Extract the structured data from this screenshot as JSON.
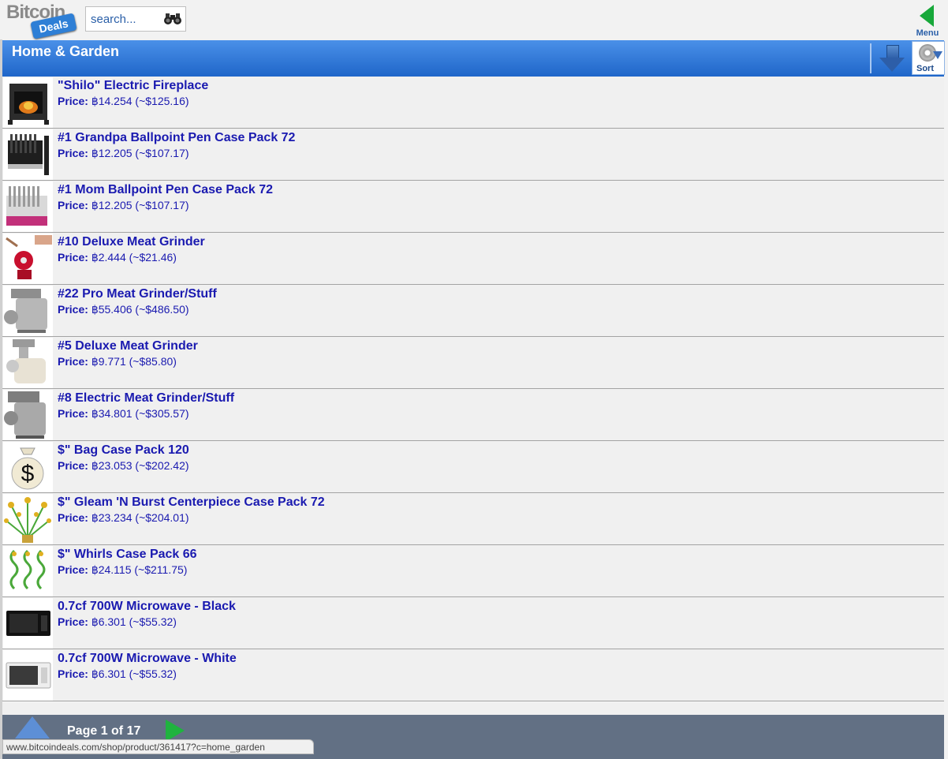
{
  "header": {
    "logo_text_top": "Bitcoin",
    "logo_text_tag": "Deals",
    "search_placeholder": "search...",
    "menu_label": "Menu"
  },
  "category": {
    "title": "Home & Garden",
    "sort_label": "Sort"
  },
  "price_label": "Price:",
  "products": [
    {
      "name": "\"Shilo\" Electric Fireplace",
      "price": "฿14.254 (~$125.16)",
      "icon": "fireplace"
    },
    {
      "name": "#1 Grandpa Ballpoint Pen Case Pack 72",
      "price": "฿12.205 (~$107.17)",
      "icon": "pens"
    },
    {
      "name": "#1 Mom Ballpoint Pen Case Pack 72",
      "price": "฿12.205 (~$107.17)",
      "icon": "pens"
    },
    {
      "name": "#10 Deluxe Meat Grinder",
      "price": "฿2.444 (~$21.46)",
      "icon": "grinder"
    },
    {
      "name": "#22 Pro Meat Grinder/Stuff",
      "price": "฿55.406 (~$486.50)",
      "icon": "grinder"
    },
    {
      "name": "#5 Deluxe Meat Grinder",
      "price": "฿9.771 (~$85.80)",
      "icon": "grinder"
    },
    {
      "name": "#8 Electric Meat Grinder/Stuff",
      "price": "฿34.801 (~$305.57)",
      "icon": "grinder"
    },
    {
      "name": "$\" Bag Case Pack 120",
      "price": "฿23.053 (~$202.42)",
      "icon": "money-bag"
    },
    {
      "name": "$\" Gleam 'N Burst Centerpiece Case Pack 72",
      "price": "฿23.234 (~$204.01)",
      "icon": "centerpiece"
    },
    {
      "name": "$\" Whirls Case Pack 66",
      "price": "฿24.115 (~$211.75)",
      "icon": "whirls"
    },
    {
      "name": "0.7cf 700W Microwave - Black",
      "price": "฿6.301 (~$55.32)",
      "icon": "microwave-black"
    },
    {
      "name": "0.7cf 700W Microwave - White",
      "price": "฿6.301 (~$55.32)",
      "icon": "microwave-white"
    }
  ],
  "pager": {
    "page_text": "Page 1 of 17"
  },
  "status_url": "www.bitcoindeals.com/shop/product/361417?c=home_garden"
}
